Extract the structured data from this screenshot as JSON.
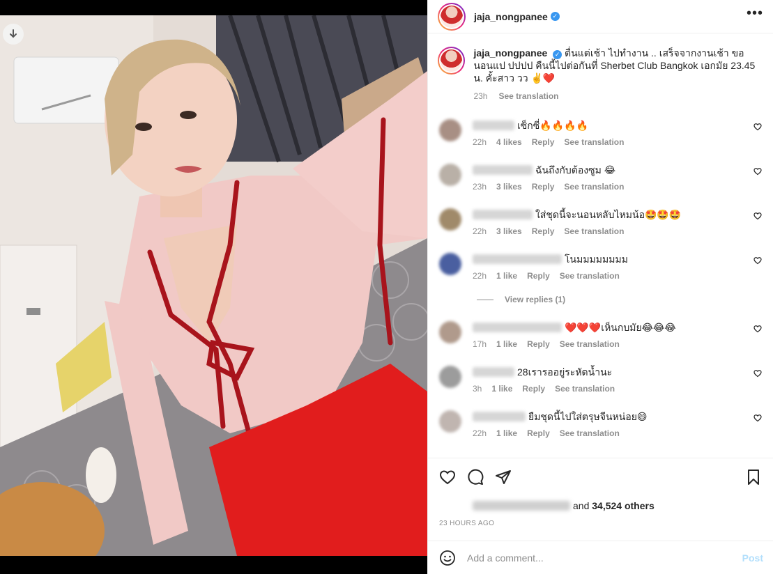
{
  "post": {
    "username": "jaja_nongpanee",
    "verified": true,
    "caption_user": "jaja_nongpanee",
    "caption_text": "ตื่นแต่เช้า ไปทำงาน .. เสร็จจากงานเช้า ขอนอนแป ปปปป คืนนี้ไปต่อกันที่ Sherbet Club Bangkok เอกมัย 23.45 น. คั้ะสาว วว ✌️❤️",
    "caption_time": "23h",
    "see_translation": "See translation"
  },
  "comments": [
    {
      "text": "เซ็กซี่🔥🔥🔥🔥",
      "time": "22h",
      "likes": "4 likes",
      "reply": "Reply",
      "translate": "See translation",
      "avatar_color": "#a88f84"
    },
    {
      "text": "ฉันถึงกับต้องซูม 😂",
      "time": "23h",
      "likes": "3 likes",
      "reply": "Reply",
      "translate": "See translation",
      "avatar_color": "#b9b0a7"
    },
    {
      "text": "ใส่ชุดนี้จะนอนหลับไหมน้อ🤩🤩🤩",
      "time": "22h",
      "likes": "3 likes",
      "reply": "Reply",
      "translate": "See translation",
      "avatar_color": "#a08a6a"
    },
    {
      "text": "โนมมมมมมมม",
      "time": "22h",
      "likes": "1 like",
      "reply": "Reply",
      "translate": "See translation",
      "avatar_color": "#4a5fa0"
    },
    {
      "text": "❤️❤️❤️เห็นกบมัย😂😂😂",
      "time": "17h",
      "likes": "1 like",
      "reply": "Reply",
      "translate": "See translation",
      "avatar_color": "#b09a8c"
    },
    {
      "text": "28เรารออยู่ระหัดน้ำนะ",
      "time": "3h",
      "likes": "1 like",
      "reply": "Reply",
      "translate": "See translation",
      "avatar_color": "#9c9c9c"
    },
    {
      "text": "ยืมชุดนี้ไปใส่ตรุษจีนหน่อย😄",
      "time": "22h",
      "likes": "1 like",
      "reply": "Reply",
      "translate": "See translation",
      "avatar_color": "#c0b5b0"
    }
  ],
  "view_replies": "View replies (1)",
  "likes": {
    "and": "and",
    "count": "34,524 others"
  },
  "timestamp": "23 HOURS AGO",
  "add_comment": {
    "placeholder": "Add a comment...",
    "post_label": "Post"
  },
  "colors": {
    "accent": "#0095f6",
    "verified": "#3897f0",
    "like_heart": "#ed4956",
    "post_disabled": "#b2dffc"
  }
}
